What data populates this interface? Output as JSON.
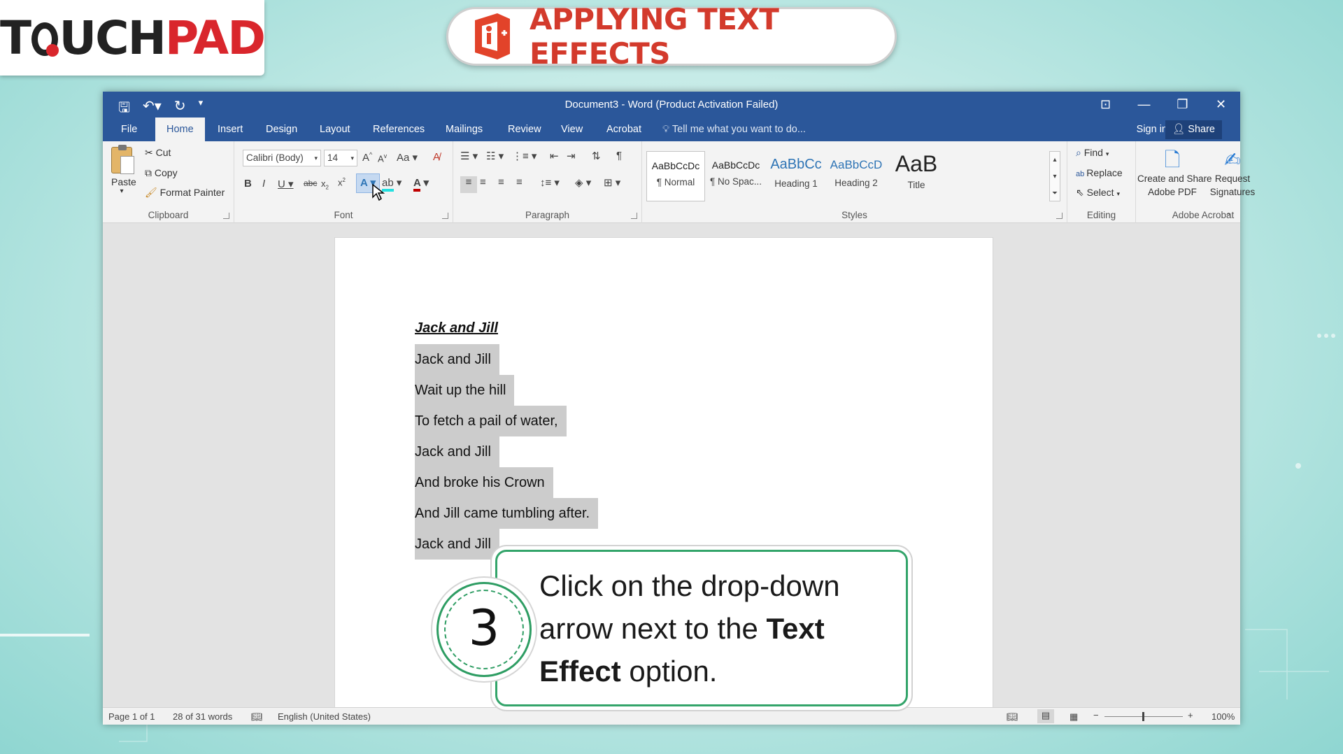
{
  "brand": {
    "logo_part1": "T",
    "logo_part2": "UCH",
    "logo_part3": "PAD",
    "accent": "#d9262c"
  },
  "banner": {
    "title": "APPLYING TEXT EFFECTS",
    "icon": "office-logo-icon"
  },
  "window": {
    "title": "Document3 - Word (Product Activation Failed)",
    "colors": {
      "titlebar": "#2b579a",
      "selection": "#cccccc"
    }
  },
  "tabs": [
    {
      "label": "File"
    },
    {
      "label": "Home"
    },
    {
      "label": "Insert"
    },
    {
      "label": "Design"
    },
    {
      "label": "Layout"
    },
    {
      "label": "References"
    },
    {
      "label": "Mailings"
    },
    {
      "label": "Review"
    },
    {
      "label": "View"
    },
    {
      "label": "Acrobat"
    }
  ],
  "tell_me": "Tell me what you want to do...",
  "sign_in": "Sign in",
  "share": "Share",
  "clipboard": {
    "paste": "Paste",
    "cut": "Cut",
    "copy": "Copy",
    "format_painter": "Format Painter",
    "label": "Clipboard"
  },
  "font": {
    "name": "Calibri (Body)",
    "size": "14",
    "case": "Aa",
    "label": "Font"
  },
  "paragraph": {
    "label": "Paragraph"
  },
  "styles": {
    "items": [
      {
        "preview": "AaBbCcDc",
        "name": "¶ Normal"
      },
      {
        "preview": "AaBbCcDc",
        "name": "¶ No Spac..."
      },
      {
        "preview": "AaBbCc",
        "name": "Heading 1"
      },
      {
        "preview": "AaBbCcD",
        "name": "Heading 2"
      },
      {
        "preview": "AaB",
        "name": "Title"
      }
    ],
    "label": "Styles"
  },
  "editing": {
    "find": "Find",
    "replace": "Replace",
    "select": "Select",
    "label": "Editing"
  },
  "acrobat": {
    "create_share_1": "Create and Share",
    "create_share_2": "Adobe PDF",
    "request_1": "Request",
    "request_2": "Signatures",
    "label": "Adobe Acrobat"
  },
  "document": {
    "heading": "Jack and Jill",
    "lines": [
      "Jack and Jill",
      "Wait up the hill",
      "To fetch a pail of water,",
      "Jack and Jill",
      "And broke his Crown",
      "And Jill came tumbling after.",
      "Jack and Jill"
    ]
  },
  "status": {
    "page": "Page 1 of 1",
    "words": "28 of 31 words",
    "language": "English (United States)",
    "zoom": "100%"
  },
  "callout": {
    "step": "3",
    "text_1": "Click on the drop-down",
    "text_2": "arrow next to the",
    "text_bold_1": "Text",
    "text_bold_2": "Effect",
    "text_3": "option."
  }
}
